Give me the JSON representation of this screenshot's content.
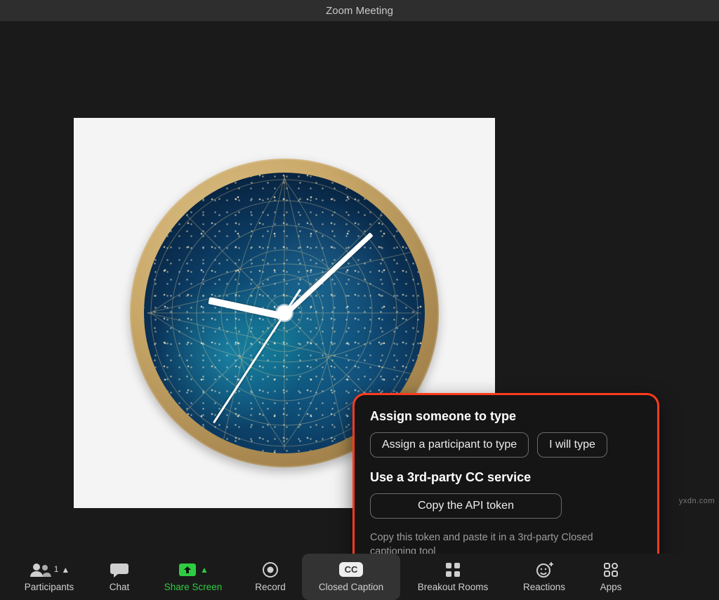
{
  "window": {
    "title": "Zoom Meeting"
  },
  "popup": {
    "section1_title": "Assign someone to type",
    "assign_btn": "Assign a participant to type",
    "iwilltype_btn": "I will type",
    "section2_title": "Use a 3rd-party CC service",
    "copy_btn": "Copy the API token",
    "note": "Copy this token and paste it in a 3rd-party Closed captioning tool"
  },
  "toolbar": {
    "participants": {
      "label": "Participants",
      "count": "1"
    },
    "chat": {
      "label": "Chat"
    },
    "share": {
      "label": "Share Screen"
    },
    "record": {
      "label": "Record"
    },
    "cc": {
      "label": "Closed Caption",
      "badge": "CC"
    },
    "breakout": {
      "label": "Breakout Rooms"
    },
    "reactions": {
      "label": "Reactions"
    },
    "apps": {
      "label": "Apps"
    }
  },
  "watermark": "yxdn.com"
}
